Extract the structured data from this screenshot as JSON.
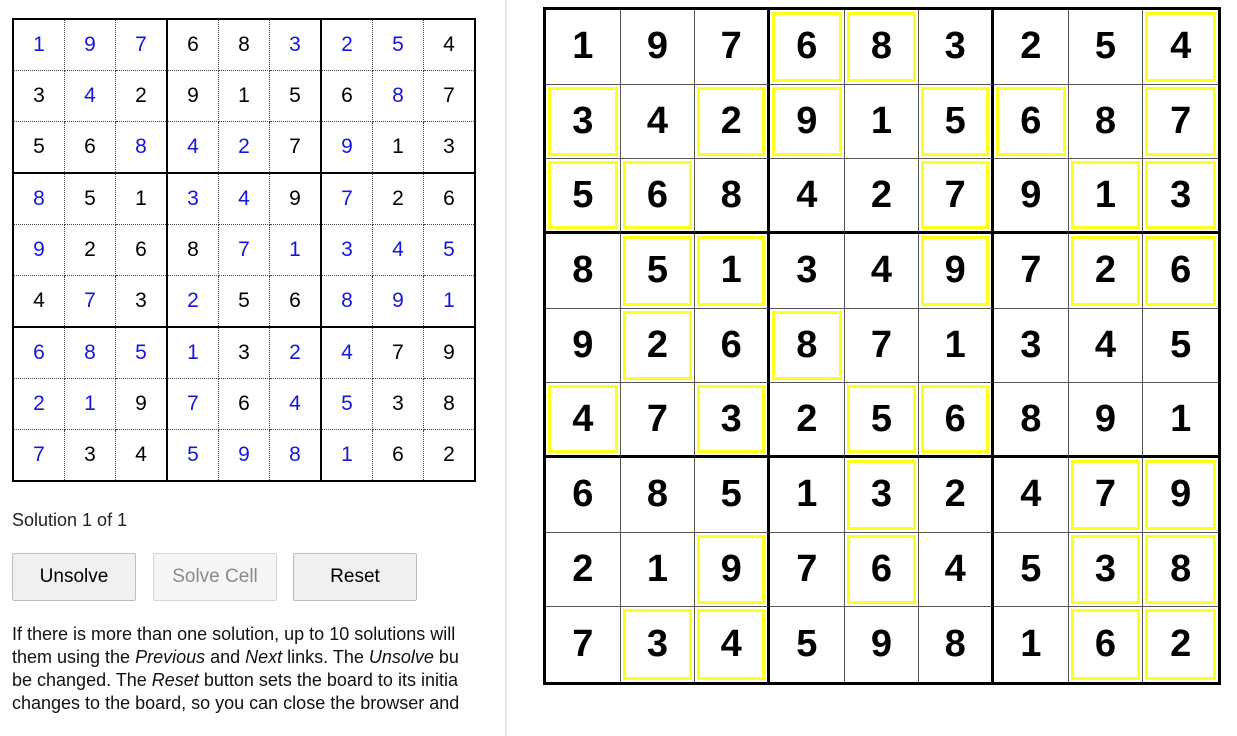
{
  "small_grid": {
    "values": [
      [
        1,
        9,
        7,
        6,
        8,
        3,
        2,
        5,
        4
      ],
      [
        3,
        4,
        2,
        9,
        1,
        5,
        6,
        8,
        7
      ],
      [
        5,
        6,
        8,
        4,
        2,
        7,
        9,
        1,
        3
      ],
      [
        8,
        5,
        1,
        3,
        4,
        9,
        7,
        2,
        6
      ],
      [
        9,
        2,
        6,
        8,
        7,
        1,
        3,
        4,
        5
      ],
      [
        4,
        7,
        3,
        2,
        5,
        6,
        8,
        9,
        1
      ],
      [
        6,
        8,
        5,
        1,
        3,
        2,
        4,
        7,
        9
      ],
      [
        2,
        1,
        9,
        7,
        6,
        4,
        5,
        3,
        8
      ],
      [
        7,
        3,
        4,
        5,
        9,
        8,
        1,
        6,
        2
      ]
    ],
    "solved_mask": [
      [
        1,
        1,
        1,
        0,
        0,
        1,
        1,
        1,
        0
      ],
      [
        0,
        1,
        0,
        0,
        0,
        0,
        0,
        1,
        0
      ],
      [
        0,
        0,
        1,
        1,
        1,
        0,
        1,
        0,
        0
      ],
      [
        1,
        0,
        0,
        1,
        1,
        0,
        1,
        0,
        0
      ],
      [
        1,
        0,
        0,
        0,
        1,
        1,
        1,
        1,
        1
      ],
      [
        0,
        1,
        0,
        1,
        0,
        0,
        1,
        1,
        1
      ],
      [
        1,
        1,
        1,
        1,
        0,
        1,
        1,
        0,
        0
      ],
      [
        1,
        1,
        0,
        1,
        0,
        1,
        1,
        0,
        0
      ],
      [
        1,
        0,
        0,
        1,
        1,
        1,
        1,
        0,
        0
      ]
    ],
    "solved_color": "#1515e0",
    "given_color": "#000000"
  },
  "status": {
    "solution_text": "Solution 1 of 1"
  },
  "buttons": {
    "unsolve": "Unsolve",
    "solve_cell": "Solve Cell",
    "reset": "Reset"
  },
  "instructions": {
    "line1": "If there is more than one solution, up to 10 solutions will",
    "line2": [
      {
        "t": "them using the ",
        "em": false
      },
      {
        "t": "Previous",
        "em": true
      },
      {
        "t": " and ",
        "em": false
      },
      {
        "t": "Next",
        "em": true
      },
      {
        "t": " links. The ",
        "em": false
      },
      {
        "t": "Unsolve",
        "em": true
      },
      {
        "t": " bu",
        "em": false
      }
    ],
    "line3": [
      {
        "t": "be changed. The ",
        "em": false
      },
      {
        "t": "Reset",
        "em": true
      },
      {
        "t": " button sets the board to its initia",
        "em": false
      }
    ],
    "line4": "changes to the board, so you can close the browser and"
  },
  "big_grid": {
    "values": [
      [
        1,
        9,
        7,
        6,
        8,
        3,
        2,
        5,
        4
      ],
      [
        3,
        4,
        2,
        9,
        1,
        5,
        6,
        8,
        7
      ],
      [
        5,
        6,
        8,
        4,
        2,
        7,
        9,
        1,
        3
      ],
      [
        8,
        5,
        1,
        3,
        4,
        9,
        7,
        2,
        6
      ],
      [
        9,
        2,
        6,
        8,
        7,
        1,
        3,
        4,
        5
      ],
      [
        4,
        7,
        3,
        2,
        5,
        6,
        8,
        9,
        1
      ],
      [
        6,
        8,
        5,
        1,
        3,
        2,
        4,
        7,
        9
      ],
      [
        2,
        1,
        9,
        7,
        6,
        4,
        5,
        3,
        8
      ],
      [
        7,
        3,
        4,
        5,
        9,
        8,
        1,
        6,
        2
      ]
    ],
    "highlight_mask": [
      [
        0,
        0,
        0,
        1,
        1,
        0,
        0,
        0,
        1
      ],
      [
        1,
        0,
        1,
        1,
        0,
        1,
        1,
        0,
        1
      ],
      [
        1,
        1,
        0,
        0,
        0,
        1,
        0,
        1,
        1
      ],
      [
        0,
        1,
        1,
        0,
        0,
        1,
        0,
        1,
        1
      ],
      [
        0,
        1,
        0,
        1,
        0,
        0,
        0,
        0,
        0
      ],
      [
        1,
        0,
        1,
        0,
        1,
        1,
        0,
        0,
        0
      ],
      [
        0,
        0,
        0,
        0,
        1,
        0,
        0,
        1,
        1
      ],
      [
        0,
        0,
        1,
        0,
        1,
        0,
        0,
        1,
        1
      ],
      [
        0,
        1,
        1,
        0,
        0,
        0,
        0,
        1,
        1
      ]
    ],
    "highlight_color": "#ffff1e"
  }
}
